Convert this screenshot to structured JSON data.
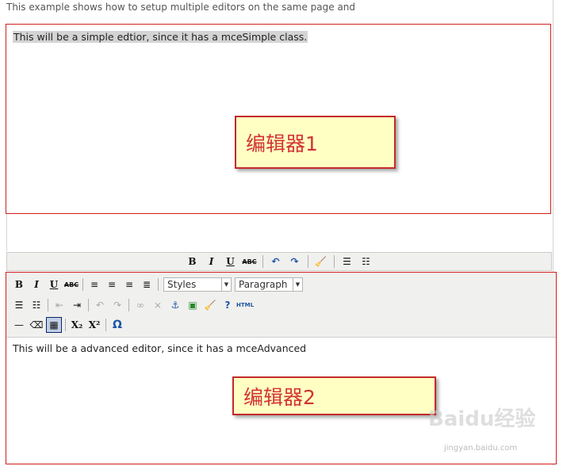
{
  "intro": "This example shows how to setup multiple editors on the same page and",
  "editor1": {
    "text": "This will be a simple edtior, since it has a mceSimple class."
  },
  "callouts": {
    "one": "编辑器1",
    "two": "编辑器2"
  },
  "simple_toolbar": {
    "bold": "B",
    "italic": "I",
    "underline": "U",
    "strike": "ABC"
  },
  "advanced_toolbar": {
    "bold": "B",
    "italic": "I",
    "underline": "U",
    "strike": "ABC",
    "styles": "Styles",
    "format": "Paragraph",
    "html": "HTML",
    "subscript": "X₂",
    "superscript": "X²",
    "charmap": "Ω"
  },
  "editor2": {
    "text": "This will be a advanced editor, since it has a mceAdvanced"
  },
  "watermark": {
    "logo": "Baidu经验",
    "url": "jingyan.baidu.com"
  }
}
